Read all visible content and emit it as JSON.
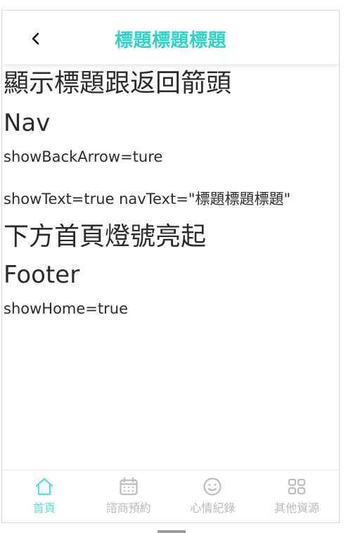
{
  "nav": {
    "title": "標題標題標題",
    "back_icon": "chevron-left-icon"
  },
  "content": {
    "heading1": "顯示標題跟返回箭頭",
    "subheading1": "Nav",
    "line1": "showBackArrow=ture",
    "line2": "showText=true navText=\"標題標題標題\"",
    "heading2": "下方首頁燈號亮起",
    "subheading2": "Footer",
    "line3": "showHome=true"
  },
  "footer": {
    "tabs": [
      {
        "label": "首頁",
        "icon": "home-icon",
        "active": true
      },
      {
        "label": "諮商預約",
        "icon": "calendar-icon",
        "active": false
      },
      {
        "label": "心情紀錄",
        "icon": "smiley-icon",
        "active": false
      },
      {
        "label": "其他資源",
        "icon": "grid-icon",
        "active": false
      }
    ]
  },
  "colors": {
    "accent": "#2ed3c6",
    "active_tab": "#5ce1d6",
    "inactive_tab": "#b9b9b9",
    "text": "#2b2b2b"
  }
}
